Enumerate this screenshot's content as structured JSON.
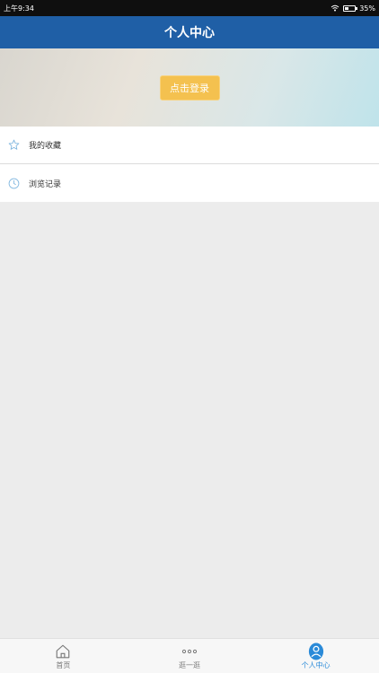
{
  "status_bar": {
    "time": "上午9:34",
    "battery": "35%",
    "battery_level": 0.35
  },
  "header": {
    "title": "个人中心"
  },
  "hero": {
    "login_label": "点击登录"
  },
  "menu": {
    "items": [
      {
        "label": "我的收藏",
        "icon": "star-icon"
      },
      {
        "label": "浏览记录",
        "icon": "clock-icon"
      }
    ]
  },
  "tab_bar": {
    "tabs": [
      {
        "label": "首页",
        "icon": "home-icon",
        "active": false
      },
      {
        "label": "逛一逛",
        "icon": "more-icon",
        "active": false
      },
      {
        "label": "个人中心",
        "icon": "user-icon",
        "active": true
      }
    ]
  },
  "colors": {
    "header": "#1f5fa6",
    "login_button": "#f4c14f",
    "active_tab": "#2a8ad8"
  }
}
